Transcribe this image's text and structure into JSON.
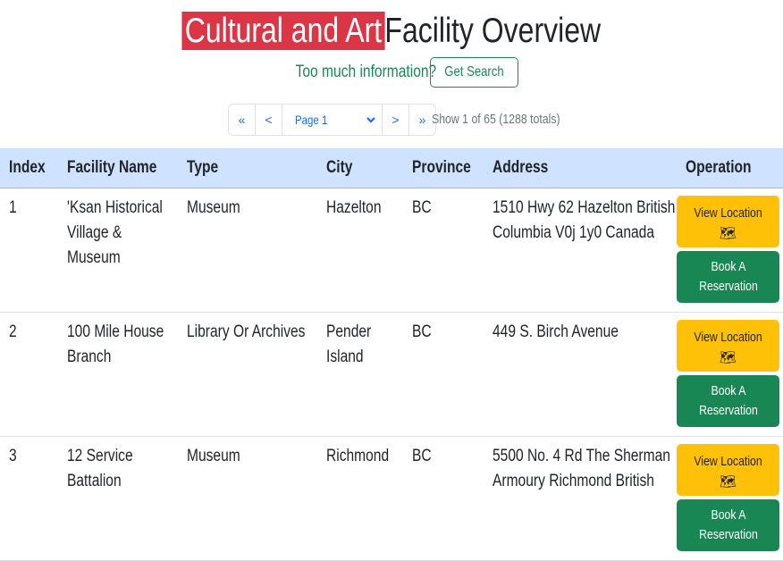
{
  "header": {
    "title_highlight": "Cultural and Art",
    "title_rest": "Facility Overview",
    "subtitle": "Too much information?",
    "search_button": "Get Search"
  },
  "pagination": {
    "first": "«",
    "prev": "<",
    "page_select": "Page 1",
    "next": ">",
    "last": "»",
    "info": "Show 1 of 65 (1288 totals)"
  },
  "table": {
    "headers": [
      "Index",
      "Facility Name",
      "Type",
      "City",
      "Province",
      "Address",
      "Operation"
    ],
    "rows": [
      {
        "index": "1",
        "name": "'Ksan Historical Village & Museum",
        "type": "Museum",
        "city": "Hazelton",
        "province": "BC",
        "address": "1510 Hwy 62 Hazelton British Columbia V0j 1y0 Canada"
      },
      {
        "index": "2",
        "name": "100 Mile House Branch",
        "type": "Library Or Archives",
        "city": "Pender Island",
        "province": "BC",
        "address": "449 S. Birch Avenue"
      },
      {
        "index": "3",
        "name": "12 Service Battalion",
        "type": "Museum",
        "city": "Richmond",
        "province": "BC",
        "address": "5500 No. 4 Rd The Sherman Armoury Richmond British"
      }
    ],
    "view_location_label": "View Location",
    "book_label": "Book A Reservation"
  },
  "colors": {
    "highlight": "#dc3545",
    "success": "#198754",
    "warning": "#ffc107",
    "primary": "#0d6efd",
    "header_bg": "#cfe2ff"
  },
  "icons": [
    "map-icon",
    "chevron-down-icon"
  ]
}
